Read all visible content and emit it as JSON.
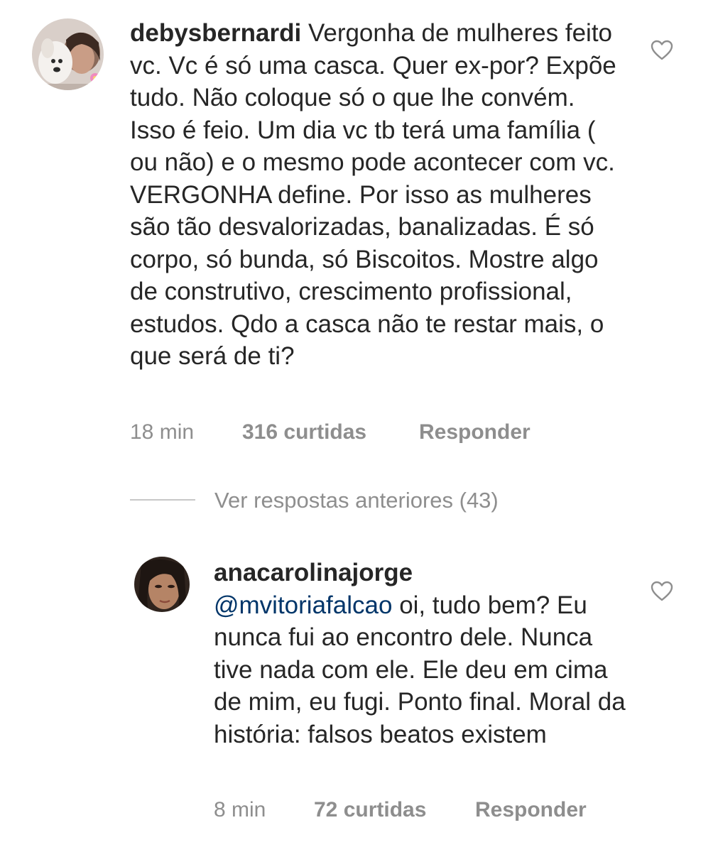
{
  "comments": [
    {
      "username": "debysbernardi",
      "text": "Vergonha de mulheres feito vc.  Vc é só uma casca. Quer ex-por? Expõe tudo. Não coloque só o que lhe convém. Isso é feio. Um dia vc tb terá uma família ( ou não) e o mesmo pode acontecer com vc. VERGONHA define. Por isso as mulheres são tão desvalorizadas,  banalizadas. É só corpo, só bunda, só Biscoitos.  Mostre algo de construtivo, crescimento profissional, estudos. Qdo a casca não te restar mais, o que será de ti?",
      "time": "18 min",
      "likes": "316 curtidas",
      "reply_label": "Responder"
    },
    {
      "username": "anacarolinajorge",
      "mention": "@mvitoriafalcao",
      "text": "oi, tudo bem? Eu nunca fui ao encontro dele. Nunca tive nada com ele. Ele deu em cima de mim, eu fugi. Ponto final. Moral da história: falsos beatos existem",
      "time": "8 min",
      "likes": "72 curtidas",
      "reply_label": "Responder"
    }
  ],
  "view_replies_label": "Ver respostas anteriores (43)",
  "icons": {
    "like": "heart-outline-icon"
  },
  "colors": {
    "text": "#262626",
    "muted": "#8e8e8e",
    "mention": "#003569",
    "divider": "#c7c7c7"
  }
}
